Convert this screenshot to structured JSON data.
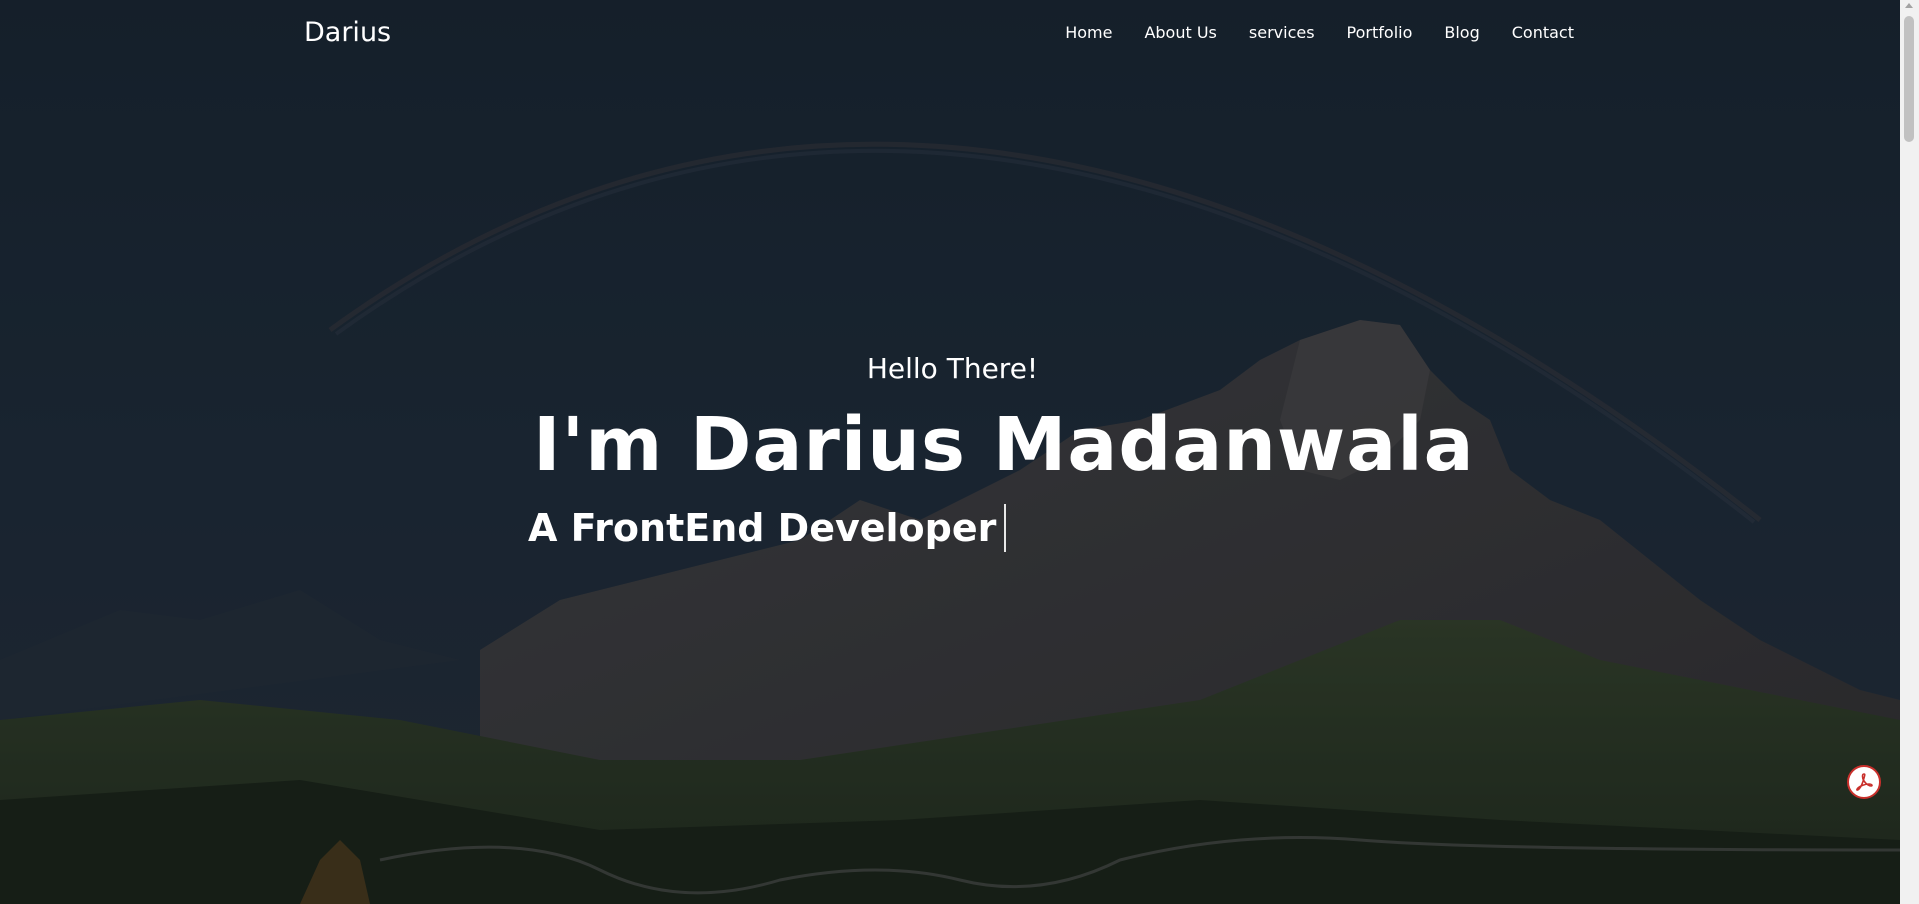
{
  "navbar": {
    "brand": "Darius",
    "links": [
      "Home",
      "About Us",
      "services",
      "Portfolio",
      "Blog",
      "Contact"
    ]
  },
  "hero": {
    "greeting": "Hello There!",
    "headline": "I'm Darius Madanwala",
    "role": "A FrontEnd Developer"
  },
  "floating_action": {
    "icon": "pdf-icon",
    "accent": "#c9302c"
  },
  "colors": {
    "text": "#ffffff",
    "background": "#1b2433"
  }
}
